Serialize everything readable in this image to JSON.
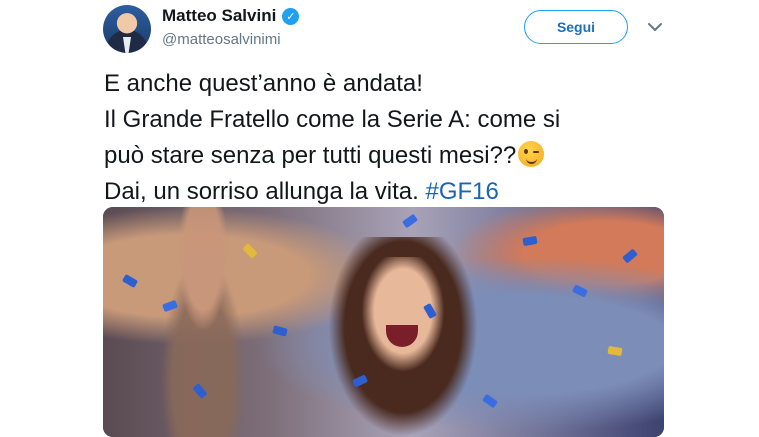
{
  "author": {
    "name": "Matteo Salvini",
    "handle": "@matteosalvinimi",
    "verified": true
  },
  "actions": {
    "follow_label": "Segui"
  },
  "tweet": {
    "lines": [
      "E anche quest’anno è andata!",
      "Il Grande Fratello come la Serie A: come si",
      "può stare senza per tutti questi mesi??",
      "Dai, un sorriso allunga la vita. "
    ],
    "hashtag": "#GF16",
    "emoji": "winking-face"
  },
  "colors": {
    "accent": "#1da1f2",
    "hashtag": "#1b64b5",
    "confetti": "#2d5fd0"
  },
  "icons": {
    "verified": "verified-badge-icon",
    "more": "chevron-down-icon"
  }
}
